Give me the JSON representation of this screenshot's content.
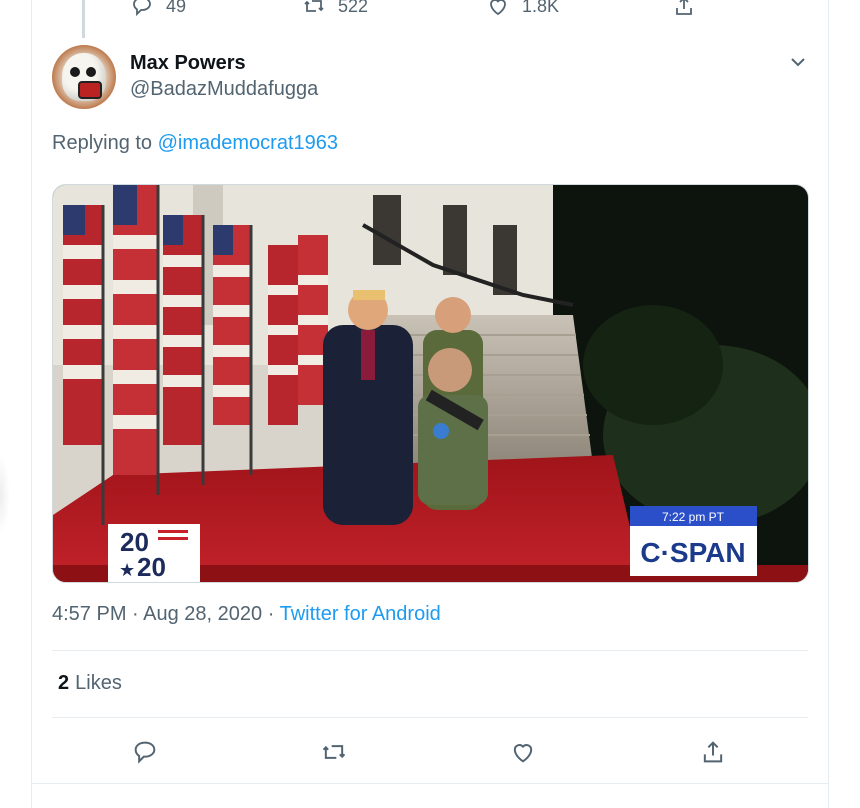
{
  "previous_tweet": {
    "reply_count": "49",
    "retweet_count": "522",
    "like_count": "1.8K"
  },
  "tweet": {
    "author_name": "Max Powers",
    "author_handle": "@BadazMuddafugga",
    "replying_prefix": "Replying to",
    "replying_to": "@imademocrat1963",
    "media": {
      "broadcast_logo": "C·SPAN",
      "broadcast_time": "7:22 pm PT",
      "event_badge_top": "20",
      "event_badge_bottom": "20"
    },
    "time": "4:57 PM",
    "date": "Aug 28, 2020",
    "source": "Twitter for Android",
    "separator": " · ",
    "likes_count": "2",
    "likes_label": "Likes"
  },
  "colors": {
    "link": "#1d9bf0",
    "secondary_text": "#536471",
    "border": "#e6ecf0"
  },
  "icons": {
    "reply": "reply-icon",
    "retweet": "retweet-icon",
    "like": "heart-icon",
    "share": "share-icon",
    "more": "chevron-down-icon"
  }
}
